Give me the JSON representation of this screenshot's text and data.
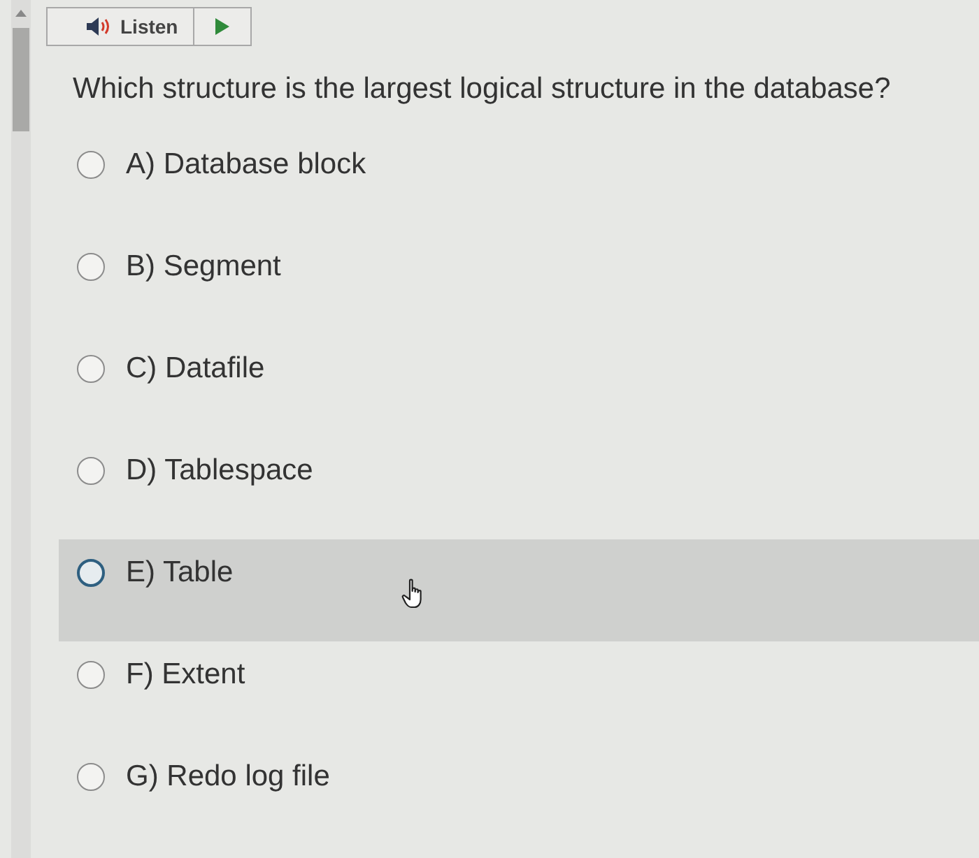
{
  "toolbar": {
    "listen_label": "Listen"
  },
  "question": {
    "text": "Which structure is the largest logical structure in the database?"
  },
  "options": [
    {
      "label": "A) Database block",
      "selected": false,
      "highlighted": false
    },
    {
      "label": "B) Segment",
      "selected": false,
      "highlighted": false
    },
    {
      "label": "C) Datafile",
      "selected": false,
      "highlighted": false
    },
    {
      "label": "D) Tablespace",
      "selected": false,
      "highlighted": false
    },
    {
      "label": "E) Table",
      "selected": false,
      "highlighted": true
    },
    {
      "label": "F) Extent",
      "selected": false,
      "highlighted": false
    },
    {
      "label": "G) Redo log file",
      "selected": false,
      "highlighted": false
    }
  ]
}
